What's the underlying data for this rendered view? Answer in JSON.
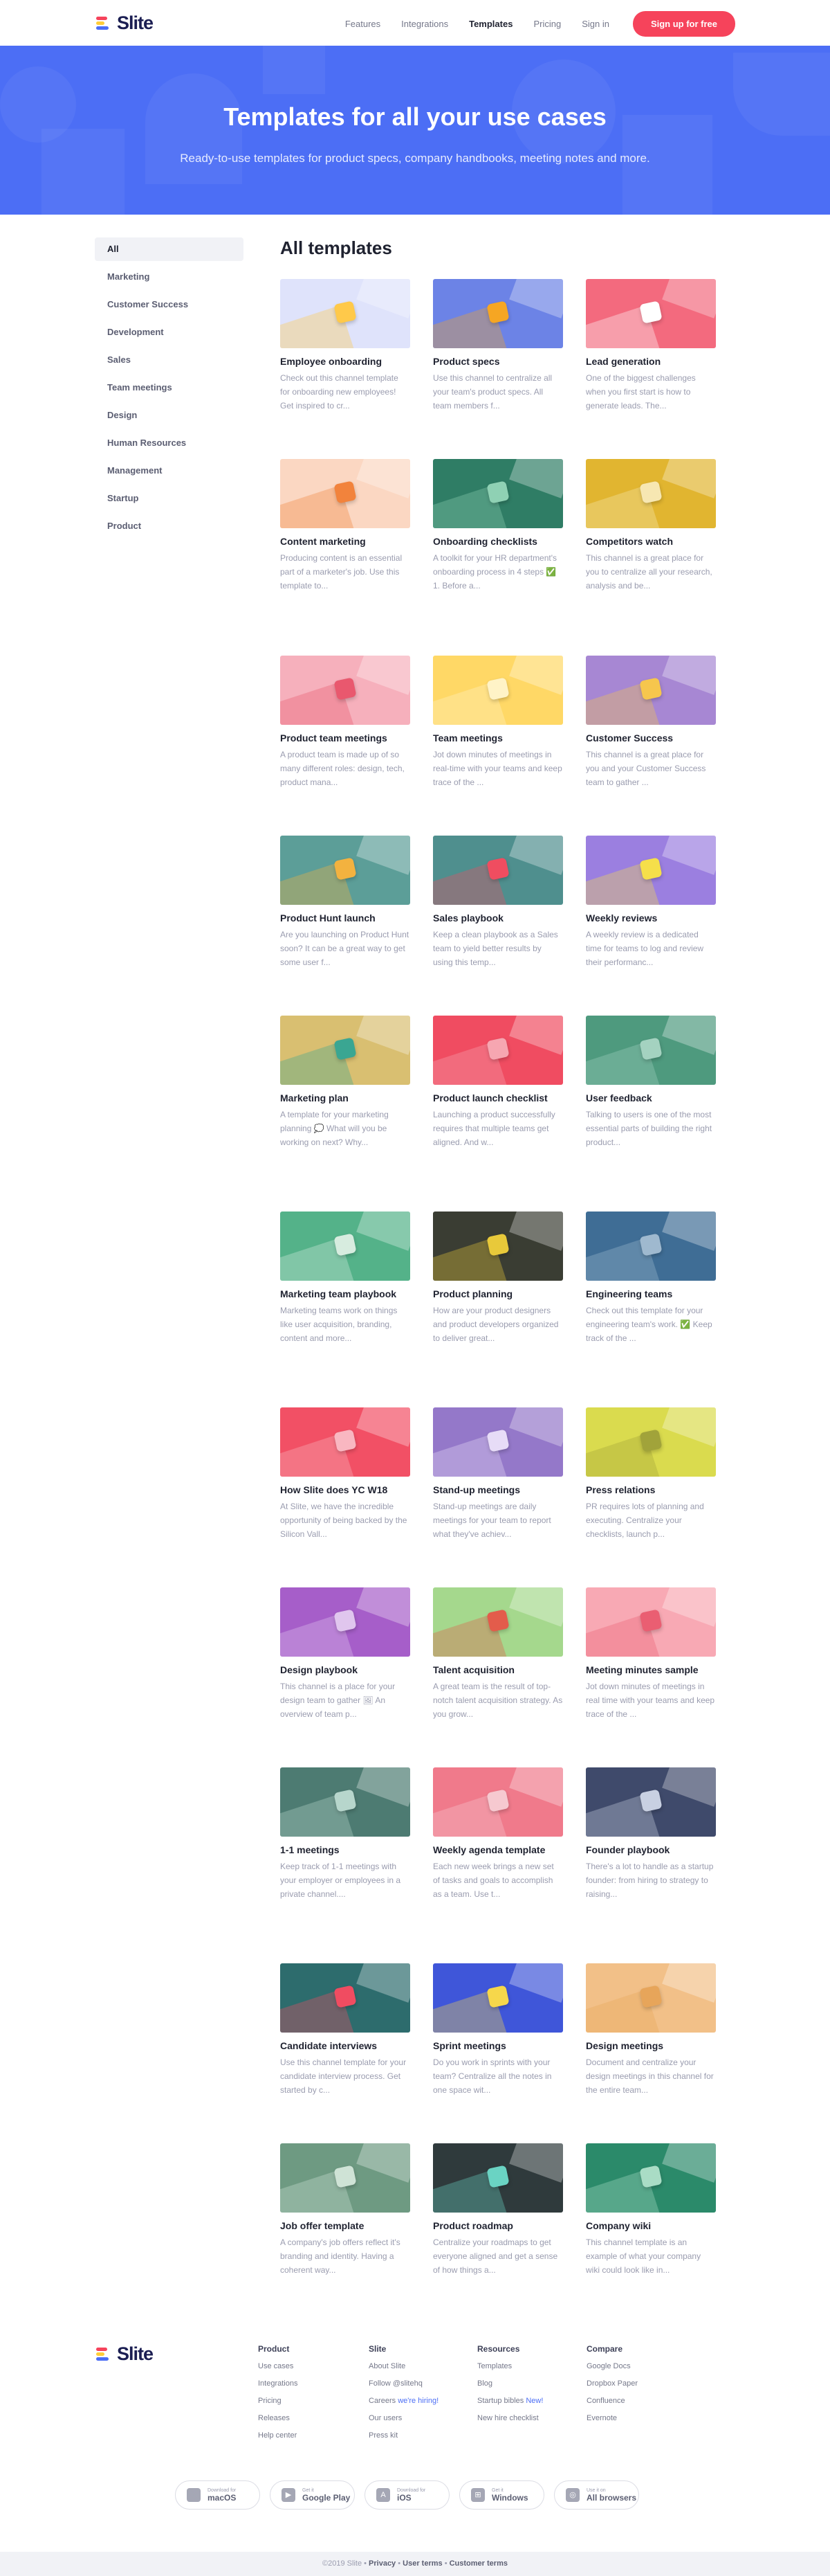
{
  "header": {
    "brand": "Slite",
    "links": [
      "Features",
      "Integrations",
      "Templates",
      "Pricing",
      "Sign in"
    ],
    "active": "Templates",
    "cta": "Sign up for free"
  },
  "hero": {
    "title": "Templates for all your use cases",
    "subtitle": "Ready-to-use templates for product specs, company handbooks, meeting notes and more."
  },
  "sidebar": {
    "items": [
      "All",
      "Marketing",
      "Customer Success",
      "Development",
      "Sales",
      "Team meetings",
      "Design",
      "Human Resources",
      "Management",
      "Startup",
      "Product"
    ],
    "active": "All"
  },
  "main": {
    "title": "All templates",
    "cards": [
      {
        "title": "Employee onboarding",
        "desc": "Check out this channel template for onboarding new employees! Get inspired to cr...",
        "bg": "#dfe3fb",
        "fg": "#ffc94a",
        "icon": "hand-icon"
      },
      {
        "title": "Product specs",
        "desc": "Use this channel to centralize all your team's product specs. All team members f...",
        "bg": "#6c83e6",
        "fg": "#f6a623",
        "icon": "pencils-icon"
      },
      {
        "title": "Lead generation",
        "desc": "One of the biggest challenges when you first start is how to generate leads. The...",
        "bg": "#f36a7e",
        "fg": "#ffffff",
        "icon": "chart-icon"
      },
      {
        "title": "Content marketing",
        "desc": "Producing content is an essential part of a marketer's job. Use this template to...",
        "bg": "#fbd7c2",
        "fg": "#f2833c",
        "icon": "typewriter-icon"
      },
      {
        "title": "Onboarding checklists",
        "desc": "A toolkit for your HR department's onboarding process in 4 steps ✅ 1. Before a...",
        "bg": "#2f7d65",
        "fg": "#8fd1b4",
        "icon": "checklist-icon"
      },
      {
        "title": "Competitors watch",
        "desc": "This channel is a great place for you to centralize all your research, analysis and be...",
        "bg": "#e1b530",
        "fg": "#f7e7b2",
        "icon": "chess-icon"
      },
      {
        "title": "Product team meetings",
        "desc": "A product team is made up of so many different roles: design, tech, product mana...",
        "bg": "#f6b0bc",
        "fg": "#e9586e",
        "icon": "people-icon"
      },
      {
        "title": "Team meetings",
        "desc": "Jot down minutes of meetings in real-time with your teams and keep trace of the ...",
        "bg": "#ffd866",
        "fg": "#fff3c7",
        "icon": "notes-icon"
      },
      {
        "title": "Customer Success",
        "desc": "This channel is a great place for you and your Customer Success team to gather ...",
        "bg": "#a787d3",
        "fg": "#f6c64d",
        "icon": "arrows-icon"
      },
      {
        "title": "Product Hunt launch",
        "desc": "Are you launching on Product Hunt soon? It can be a great way to get some user f...",
        "bg": "#5c9e98",
        "fg": "#f3b23f",
        "icon": "emoji-icon"
      },
      {
        "title": "Sales playbook",
        "desc": "Keep a clean playbook as a Sales team to yield better results by using this temp...",
        "bg": "#4f8f8e",
        "fg": "#ef4d60",
        "icon": "target-icon"
      },
      {
        "title": "Weekly reviews",
        "desc": "A weekly review is a dedicated time for teams to log and review their performanc...",
        "bg": "#9b7fe0",
        "fg": "#f5df4a",
        "icon": "graph-icon"
      },
      {
        "title": "Marketing plan",
        "desc": "A template for your marketing planning 💭 What will you be working on next? Why...",
        "bg": "#d9bf71",
        "fg": "#3aa692",
        "icon": "megaphone-icon"
      },
      {
        "title": "Product launch checklist",
        "desc": "Launching a product successfully requires that multiple teams get aligned. And w...",
        "bg": "#f04c61",
        "fg": "#f6a6b1",
        "icon": "rocket-icon"
      },
      {
        "title": "User feedback",
        "desc": "Talking to users is one of the most essential parts of building the right product...",
        "bg": "#4e9a7e",
        "fg": "#a4d2c0",
        "icon": "chat-icon"
      },
      {
        "title": "Marketing team playbook",
        "desc": "Marketing teams work on things like user acquisition, branding, content and more...",
        "bg": "#54b289",
        "fg": "#d7ecdf",
        "icon": "book-icon"
      },
      {
        "title": "Product planning",
        "desc": "How are your product designers and product developers organized to deliver great...",
        "bg": "#3a3d33",
        "fg": "#e8c93a",
        "icon": "desk-icon"
      },
      {
        "title": "Engineering teams",
        "desc": "Check out this template for your engineering team's work. ✅ Keep track of the ...",
        "bg": "#3f6d95",
        "fg": "#9fb9cf",
        "icon": "code-icon"
      },
      {
        "title": "How Slite does YC W18",
        "desc": "At Slite, we have the incredible opportunity of being backed by the Silicon Vall...",
        "bg": "#f25065",
        "fg": "#f9b7c1",
        "icon": "rocket-icon"
      },
      {
        "title": "Stand-up meetings",
        "desc": "Stand-up meetings are daily meetings for your team to report what they've achiev...",
        "bg": "#9478c9",
        "fg": "#e7dcf7",
        "icon": "pen-icon"
      },
      {
        "title": "Press relations",
        "desc": "PR requires lots of planning and executing. Centralize your checklists, launch p...",
        "bg": "#dadb4e",
        "fg": "#a1a33a",
        "icon": "paper-icon"
      },
      {
        "title": "Design playbook",
        "desc": "This channel is a place for your design team to gather 🖼 An overview of team p...",
        "bg": "#a65ec9",
        "fg": "#e0c6ee",
        "icon": "brush-icon"
      },
      {
        "title": "Talent acquisition",
        "desc": "A great team is the result of top-notch talent acquisition strategy. As you grow...",
        "bg": "#a5d88d",
        "fg": "#e35c4b",
        "icon": "handshake-icon"
      },
      {
        "title": "Meeting minutes sample",
        "desc": "Jot down minutes of meetings in real time with your teams and keep trace of the ...",
        "bg": "#f8a9b4",
        "fg": "#ea5e72",
        "icon": "pencil-icon"
      },
      {
        "title": "1-1 meetings",
        "desc": "Keep track of 1-1 meetings with your employer or employees in a private channel....",
        "bg": "#4d7b72",
        "fg": "#b7d6cc",
        "icon": "coffee-icon"
      },
      {
        "title": "Weekly agenda template",
        "desc": "Each new week brings a new set of tasks and goals to accomplish as a team. Use t...",
        "bg": "#f07a8b",
        "fg": "#f6c9d0",
        "icon": "agenda-icon"
      },
      {
        "title": "Founder playbook",
        "desc": "There's a lot to handle as a startup founder: from hiring to strategy to raising...",
        "bg": "#3f4a6b",
        "fg": "#c8d0e2",
        "icon": "desk-icon"
      },
      {
        "title": "Candidate interviews",
        "desc": "Use this channel template for your candidate interview process. Get started by c...",
        "bg": "#2d6c6d",
        "fg": "#f04c61",
        "icon": "interview-icon"
      },
      {
        "title": "Sprint meetings",
        "desc": "Do you work in sprints with your team? Centralize all the notes in one space wit...",
        "bg": "#3f56d9",
        "fg": "#f6d74b",
        "icon": "traffic-light-icon"
      },
      {
        "title": "Design meetings",
        "desc": "Document and centralize your design meetings in this channel for the entire team...",
        "bg": "#f2c088",
        "fg": "#e7a55a",
        "icon": "palette-icon"
      },
      {
        "title": "Job offer template",
        "desc": "A company's job offers reflect it's branding and identity. Having a coherent way...",
        "bg": "#6e9a82",
        "fg": "#cfe3d6",
        "icon": "laptop-icon"
      },
      {
        "title": "Product roadmap",
        "desc": "Centralize your roadmaps to get everyone aligned and get a sense of how things a...",
        "bg": "#2f3a3c",
        "fg": "#6ad3c3",
        "icon": "map-icon"
      },
      {
        "title": "Company wiki",
        "desc": "This channel template is an example of what your company wiki could look like in...",
        "bg": "#2b8a6a",
        "fg": "#a9dcc5",
        "icon": "wiki-icon"
      }
    ]
  },
  "footer": {
    "brand": "Slite",
    "columns": [
      {
        "head": "Product",
        "links": [
          "Use cases",
          "Integrations",
          "Pricing",
          "Releases",
          "Help center"
        ]
      },
      {
        "head": "Slite",
        "links": [
          "About Slite",
          "Follow @slitehq",
          "Careers",
          "Our users",
          "Press kit"
        ],
        "accent": {
          "index": 2,
          "text": "we're hiring!"
        }
      },
      {
        "head": "Resources",
        "links": [
          "Templates",
          "Blog",
          "Startup bibles",
          "New hire checklist"
        ],
        "accent": {
          "index": 2,
          "text": "New!"
        }
      },
      {
        "head": "Compare",
        "links": [
          "Google Docs",
          "Dropbox Paper",
          "Confluence",
          "Evernote"
        ]
      }
    ],
    "downloads": [
      {
        "small": "Download for",
        "big": "macOS",
        "icon": "apple-icon"
      },
      {
        "small": "Get it",
        "big": "Google Play",
        "icon": "play-icon"
      },
      {
        "small": "Download for",
        "big": "iOS",
        "icon": "appstore-icon"
      },
      {
        "small": "Get it",
        "big": "Windows",
        "icon": "windows-icon"
      },
      {
        "small": "Use it on",
        "big": "All browsers",
        "icon": "browser-icon"
      }
    ],
    "copyright": "©2019 Slite",
    "legal": [
      "Privacy",
      "User terms",
      "Customer terms"
    ]
  }
}
